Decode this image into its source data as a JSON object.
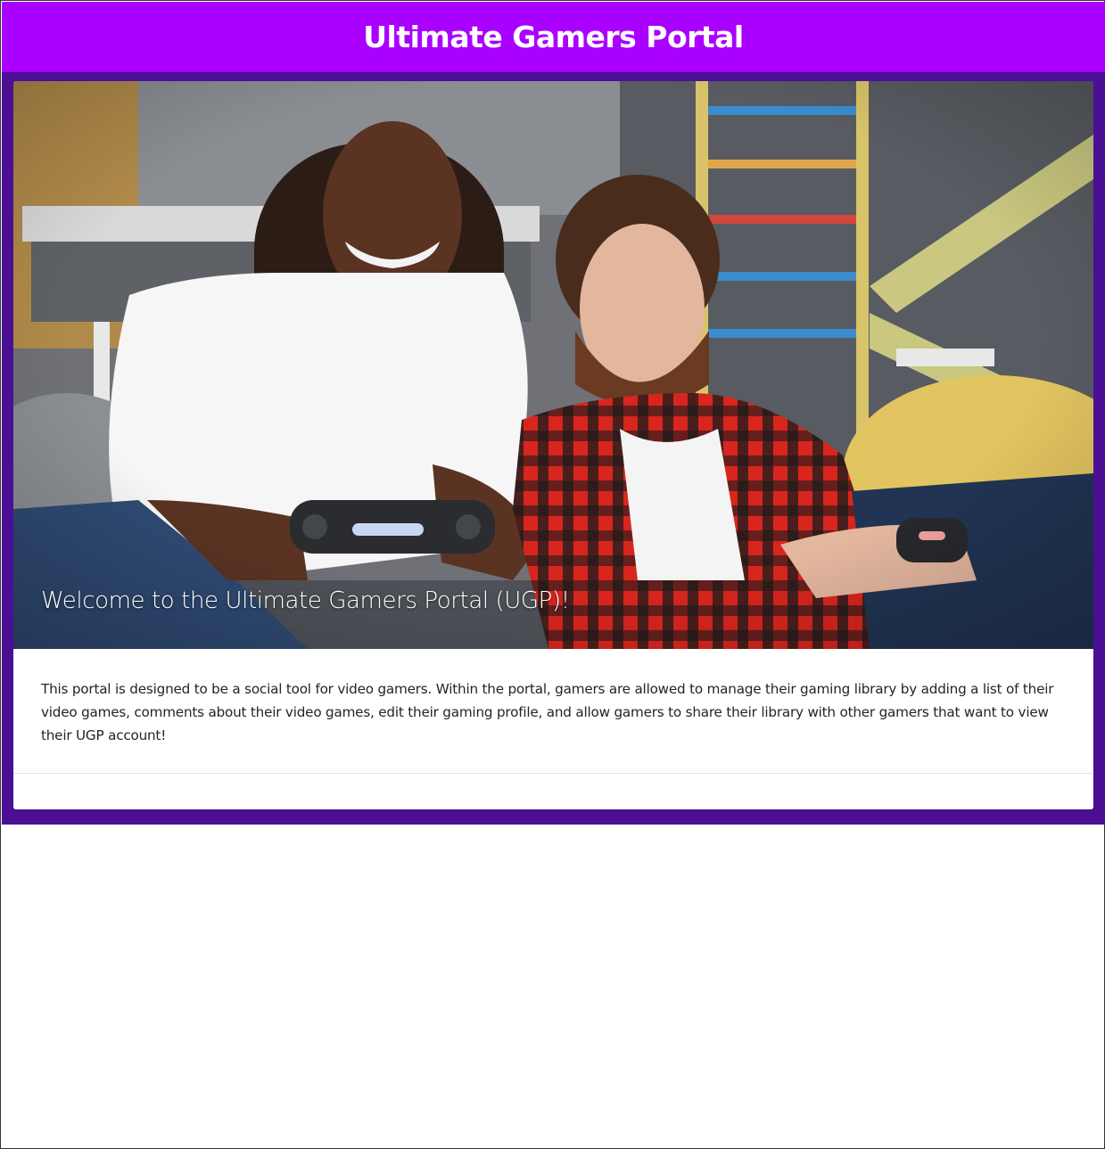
{
  "header": {
    "title": "Ultimate Gamers Portal"
  },
  "hero": {
    "caption": "Welcome to the Ultimate Gamers Portal (UGP)!",
    "image": "two-people-playing-video-games-photo"
  },
  "card": {
    "description": "This portal is designed to be a social tool for video gamers. Within the portal, gamers are allowed to manage their gaming library by adding a list of their video games, comments about their video games, edit their gaming profile, and allow gamers to share their library with other gamers that want to view their UGP account!"
  },
  "colors": {
    "header_bg": "#aa00ff",
    "band_bg": "#4a0f93",
    "card_bg": "#ffffff",
    "text": "#212529"
  }
}
